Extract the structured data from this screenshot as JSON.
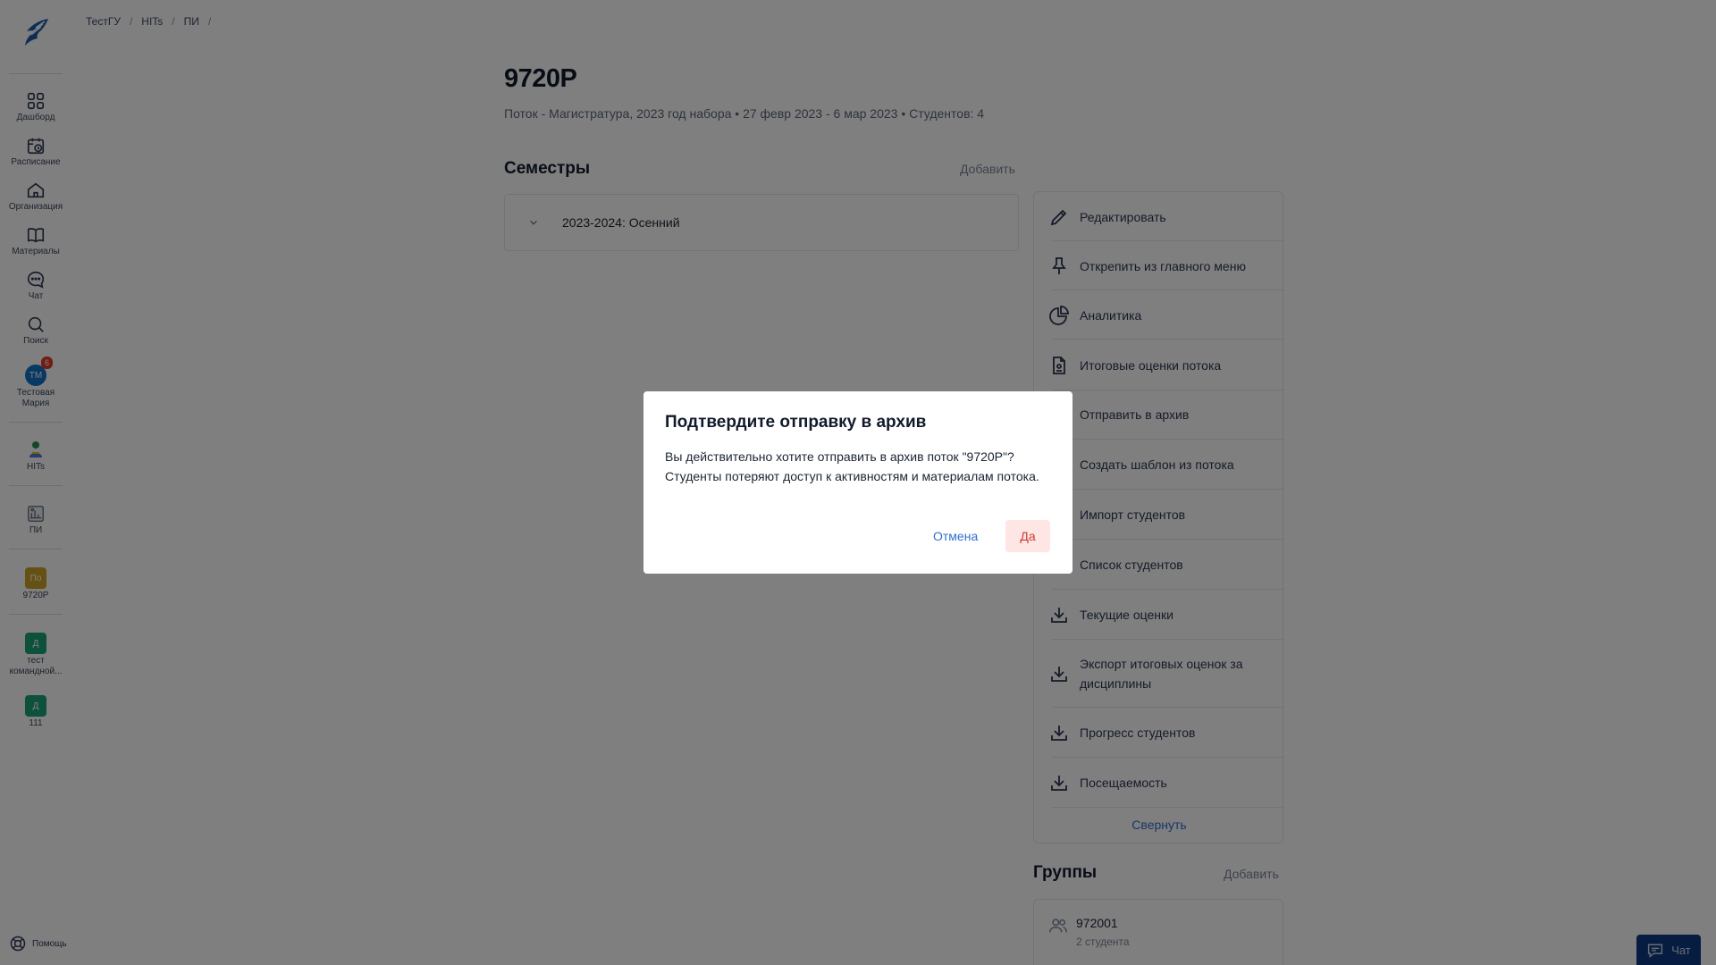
{
  "sidebar": {
    "items": [
      {
        "label": "Дашборд",
        "icon": "grid-icon"
      },
      {
        "label": "Расписание",
        "icon": "calendar-icon"
      },
      {
        "label": "Организация",
        "icon": "home-icon"
      },
      {
        "label": "Материалы",
        "icon": "book-icon"
      },
      {
        "label": "Чат",
        "icon": "chat-bubble-icon"
      },
      {
        "label": "Поиск",
        "icon": "search-icon"
      }
    ],
    "user": {
      "initials": "ТМ",
      "label": "Тестовая Мария",
      "badge": "6"
    },
    "orgs": [
      {
        "label": "HITs",
        "icon": "hits-logo-icon"
      },
      {
        "label": "ПИ",
        "icon": "building-icon"
      },
      {
        "label": "9720P",
        "initials": "По",
        "color": "#c9a227"
      },
      {
        "label": "тест командной...",
        "initials": "Д",
        "color": "#1aa37a"
      },
      {
        "label": "111",
        "initials": "Д",
        "color": "#1aa37a"
      }
    ],
    "help_label": "Помощь"
  },
  "breadcrumb": [
    "ТестГУ",
    "HITs",
    "ПИ"
  ],
  "header": {
    "title": "9720P",
    "subtitle": "Поток - Магистратура, 2023 год набора • 27 февр 2023 - 6 мар 2023 • Студентов: 4"
  },
  "semesters": {
    "heading": "Семестры",
    "add_label": "Добавить",
    "items": [
      "2023-2024: Осенний"
    ]
  },
  "actions_menu": {
    "items": [
      {
        "label": "Редактировать",
        "icon": "pencil-icon"
      },
      {
        "label": "Открепить из главного меню",
        "icon": "pin-icon"
      },
      {
        "label": "Аналитика",
        "icon": "pie-chart-icon"
      },
      {
        "label": "Итоговые оценки потока",
        "icon": "document-icon"
      },
      {
        "label": "Отправить в архив",
        "icon": "archive-icon"
      },
      {
        "label": "Создать шаблон из потока",
        "icon": "template-icon"
      },
      {
        "label": "Импорт студентов",
        "icon": "upload-icon"
      },
      {
        "label": "Список студентов",
        "icon": "download-icon"
      },
      {
        "label": "Текущие оценки",
        "icon": "download-icon"
      },
      {
        "label": "Экспорт итоговых оценок за дисциплины",
        "icon": "download-icon"
      },
      {
        "label": "Прогресс студентов",
        "icon": "download-icon"
      },
      {
        "label": "Посещаемость",
        "icon": "download-icon"
      }
    ],
    "collapse_label": "Свернуть"
  },
  "groups": {
    "heading": "Группы",
    "add_label": "Добавить",
    "items": [
      {
        "name": "972001",
        "count": "2 студента"
      }
    ]
  },
  "modal": {
    "title": "Подтвердите отправку в архив",
    "text": "Вы действительно хотите отправить в архив поток \"9720P\"? Студенты потеряют доступ к активностям и материалам потока.",
    "cancel_label": "Отмена",
    "confirm_label": "Да"
  },
  "chat_button": {
    "label": "Чат"
  },
  "colors": {
    "accent": "#2f6fcf",
    "danger": "#d13b34",
    "danger_bg": "#fde6e4",
    "chat_bg": "#0d3b82"
  }
}
